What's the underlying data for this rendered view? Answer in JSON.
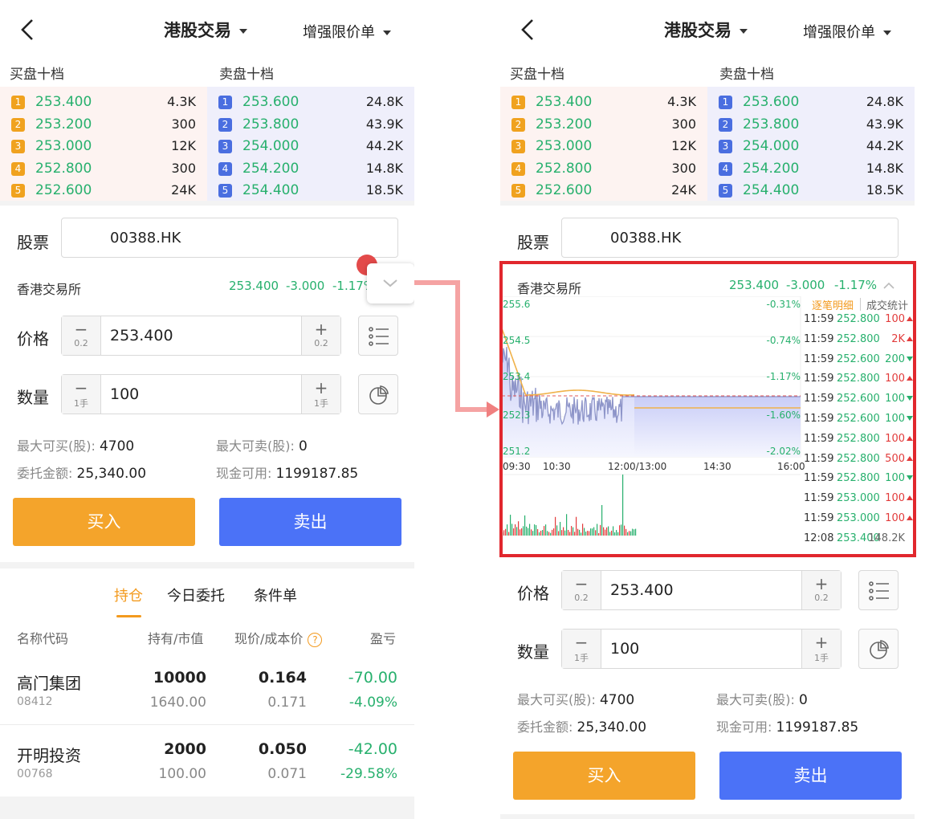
{
  "header": {
    "title": "港股交易",
    "order_type": "增强限价单"
  },
  "book": {
    "buy_title": "买盘十档",
    "sell_title": "卖盘十档",
    "buy": [
      {
        "l": "1",
        "p": "253.400",
        "v": "4.3K"
      },
      {
        "l": "2",
        "p": "253.200",
        "v": "300"
      },
      {
        "l": "3",
        "p": "253.000",
        "v": "12K"
      },
      {
        "l": "4",
        "p": "252.800",
        "v": "300"
      },
      {
        "l": "5",
        "p": "252.600",
        "v": "24K"
      }
    ],
    "sell": [
      {
        "l": "1",
        "p": "253.600",
        "v": "24.8K"
      },
      {
        "l": "2",
        "p": "253.800",
        "v": "43.9K"
      },
      {
        "l": "3",
        "p": "254.000",
        "v": "44.2K"
      },
      {
        "l": "4",
        "p": "254.200",
        "v": "14.8K"
      },
      {
        "l": "5",
        "p": "254.400",
        "v": "18.5K"
      }
    ]
  },
  "form": {
    "stock_label": "股票",
    "stock_code": "00388.HK",
    "exchange": "香港交易所",
    "quote_price": "253.400",
    "quote_change": "-3.000",
    "quote_pct": "-1.17%",
    "price_label": "价格",
    "price_value": "253.400",
    "price_step": "0.2",
    "qty_label": "数量",
    "qty_value": "100",
    "qty_step": "1手",
    "minus": "−",
    "plus": "+",
    "max_buy_label": "最大可买(股):",
    "max_buy": "4700",
    "max_sell_label": "最大可卖(股):",
    "max_sell": "0",
    "amount_label": "委托金额:",
    "amount": "25,340.00",
    "cash_label": "现金可用:",
    "cash": "1199187.85",
    "buy_btn": "买入",
    "sell_btn": "卖出"
  },
  "tabs": [
    "持仓",
    "今日委托",
    "条件单"
  ],
  "positions": {
    "headers": [
      "名称代码",
      "持有/市值",
      "现价/成本价",
      "盈亏"
    ],
    "help": "?",
    "rows": [
      {
        "name": "高门集团",
        "code": "08412",
        "hold": "10000",
        "mv": "1640.00",
        "price": "0.164",
        "cost": "0.171",
        "pl": "-70.00",
        "pct": "-4.09%"
      },
      {
        "name": "开明投资",
        "code": "00768",
        "hold": "2000",
        "mv": "100.00",
        "price": "0.050",
        "cost": "0.071",
        "pl": "-42.00",
        "pct": "-29.58%"
      }
    ]
  },
  "chart": {
    "tab_detail": "逐笔明细",
    "tab_stats": "成交统计",
    "y_labels": [
      "255.6",
      "254.5",
      "253.4",
      "252.3",
      "251.2"
    ],
    "pct_labels": [
      "-0.31%",
      "-0.74%",
      "-1.17%",
      "-1.60%",
      "-2.02%"
    ],
    "x_labels": [
      "09:30",
      "10:30",
      "12:00/13:00",
      "14:30",
      "16:00"
    ],
    "ticks": [
      {
        "t": "11:59",
        "p": "252.800",
        "v": "100",
        "d": "up"
      },
      {
        "t": "11:59",
        "p": "252.800",
        "v": "2K",
        "d": "up"
      },
      {
        "t": "11:59",
        "p": "252.600",
        "v": "200",
        "d": "dn"
      },
      {
        "t": "11:59",
        "p": "252.800",
        "v": "100",
        "d": "up"
      },
      {
        "t": "11:59",
        "p": "252.600",
        "v": "100",
        "d": "dn"
      },
      {
        "t": "11:59",
        "p": "252.600",
        "v": "100",
        "d": "dn"
      },
      {
        "t": "11:59",
        "p": "252.800",
        "v": "100",
        "d": "up"
      },
      {
        "t": "11:59",
        "p": "252.800",
        "v": "500",
        "d": "up"
      },
      {
        "t": "11:59",
        "p": "252.800",
        "v": "100",
        "d": "dn"
      },
      {
        "t": "11:59",
        "p": "253.000",
        "v": "100",
        "d": "up"
      },
      {
        "t": "11:59",
        "p": "253.000",
        "v": "100",
        "d": "up"
      },
      {
        "t": "12:08",
        "p": "253.400",
        "v": "148.2K",
        "d": "na"
      }
    ]
  },
  "colors": {
    "green": "#27b06d",
    "red": "#e23b3b",
    "orange": "#f4a42b",
    "blue": "#4b72f7",
    "highlight": "#e1272d"
  }
}
